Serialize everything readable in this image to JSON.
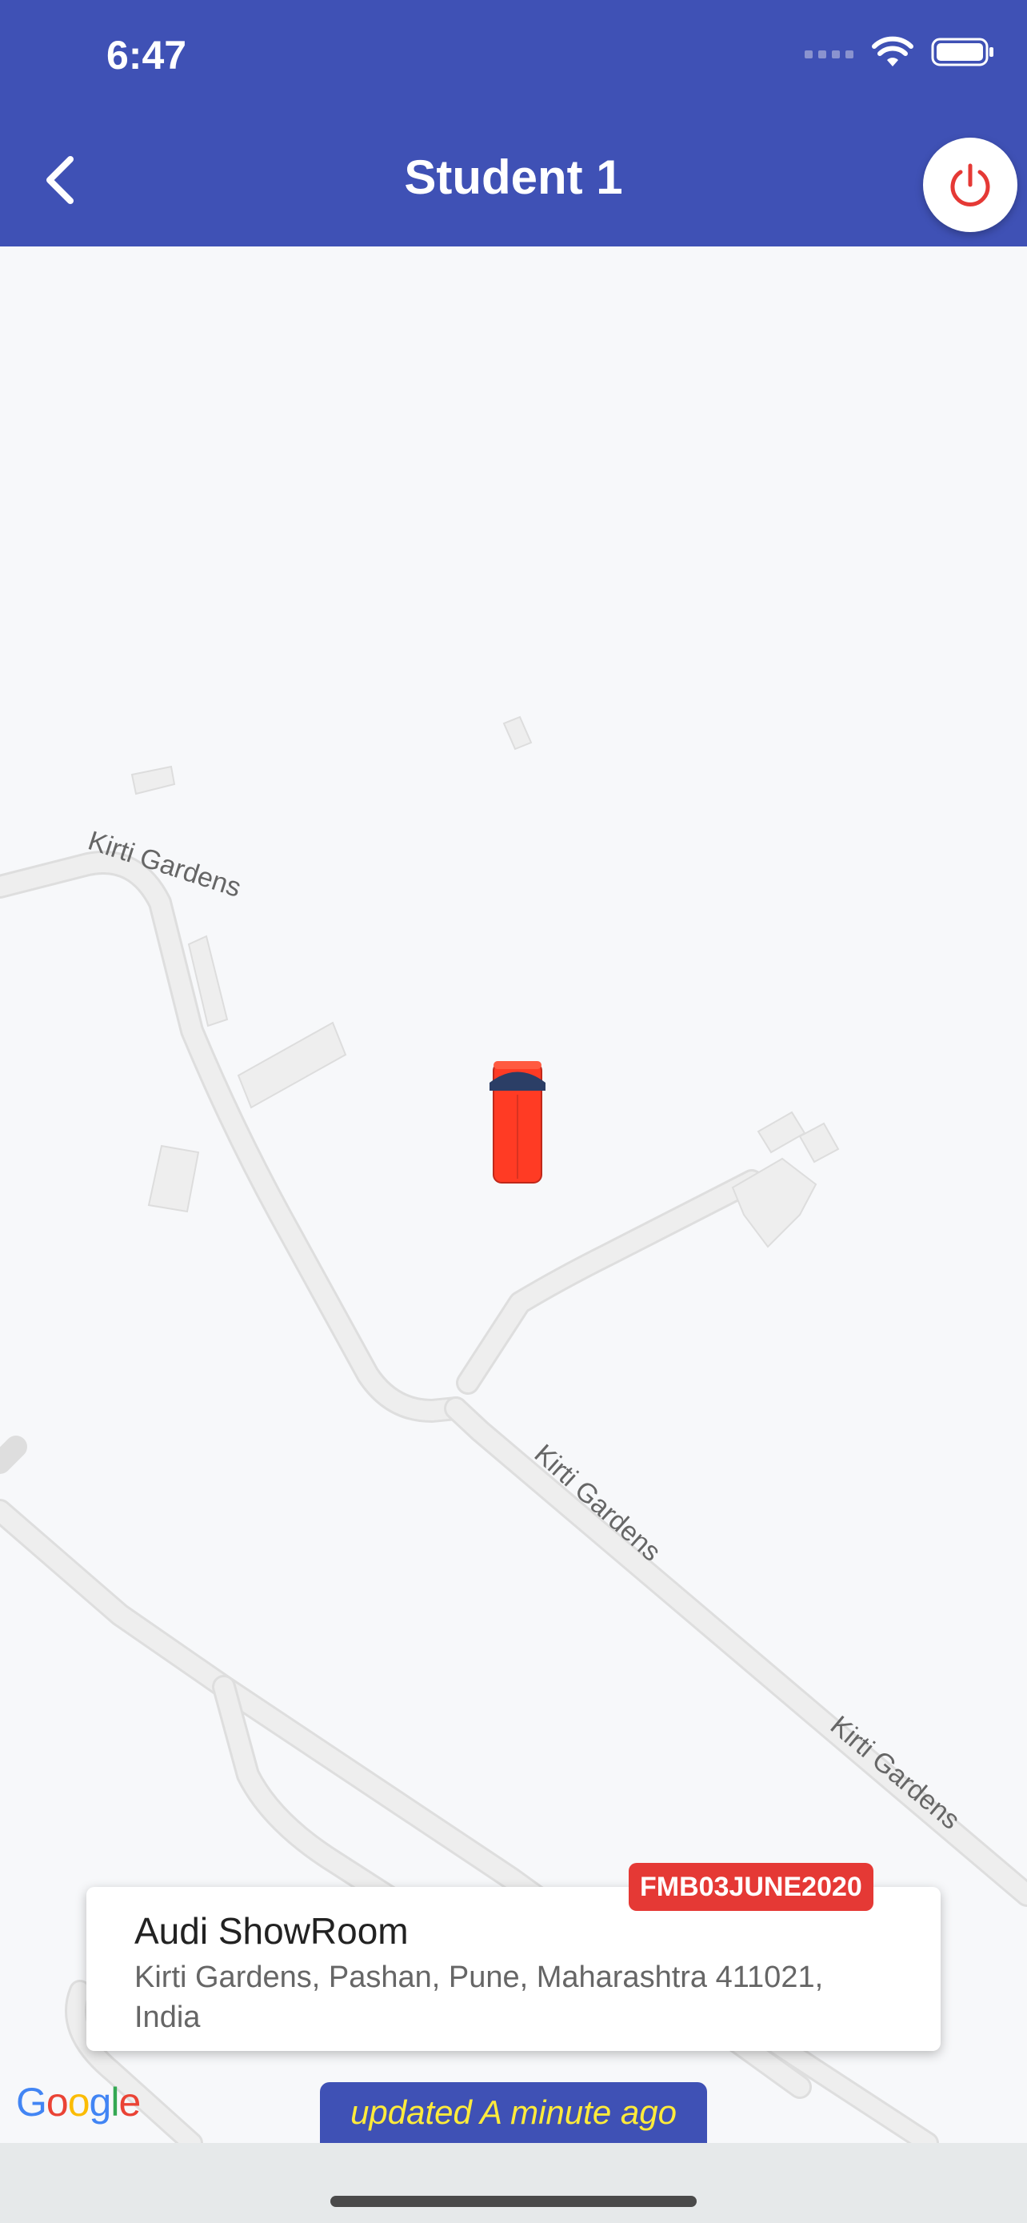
{
  "status_bar": {
    "time": "6:47"
  },
  "app_bar": {
    "title": "Student 1"
  },
  "map": {
    "road_labels": [
      "Kirti Gardens",
      "Kirti Gardens",
      "Kirti Gardens"
    ],
    "vehicle_color": "#ff3b24"
  },
  "info_card": {
    "badge": "FMB03JUNE2020",
    "place_name": "Audi ShowRoom",
    "address": "Kirti Gardens, Pashan, Pune, Maharashtra 411021, India"
  },
  "attribution": "Google",
  "updated_text": "updated A minute ago",
  "colors": {
    "primary": "#3f51b5",
    "badge": "#e53935",
    "updated_text": "#ffeb3b",
    "power_icon": "#e53935"
  }
}
